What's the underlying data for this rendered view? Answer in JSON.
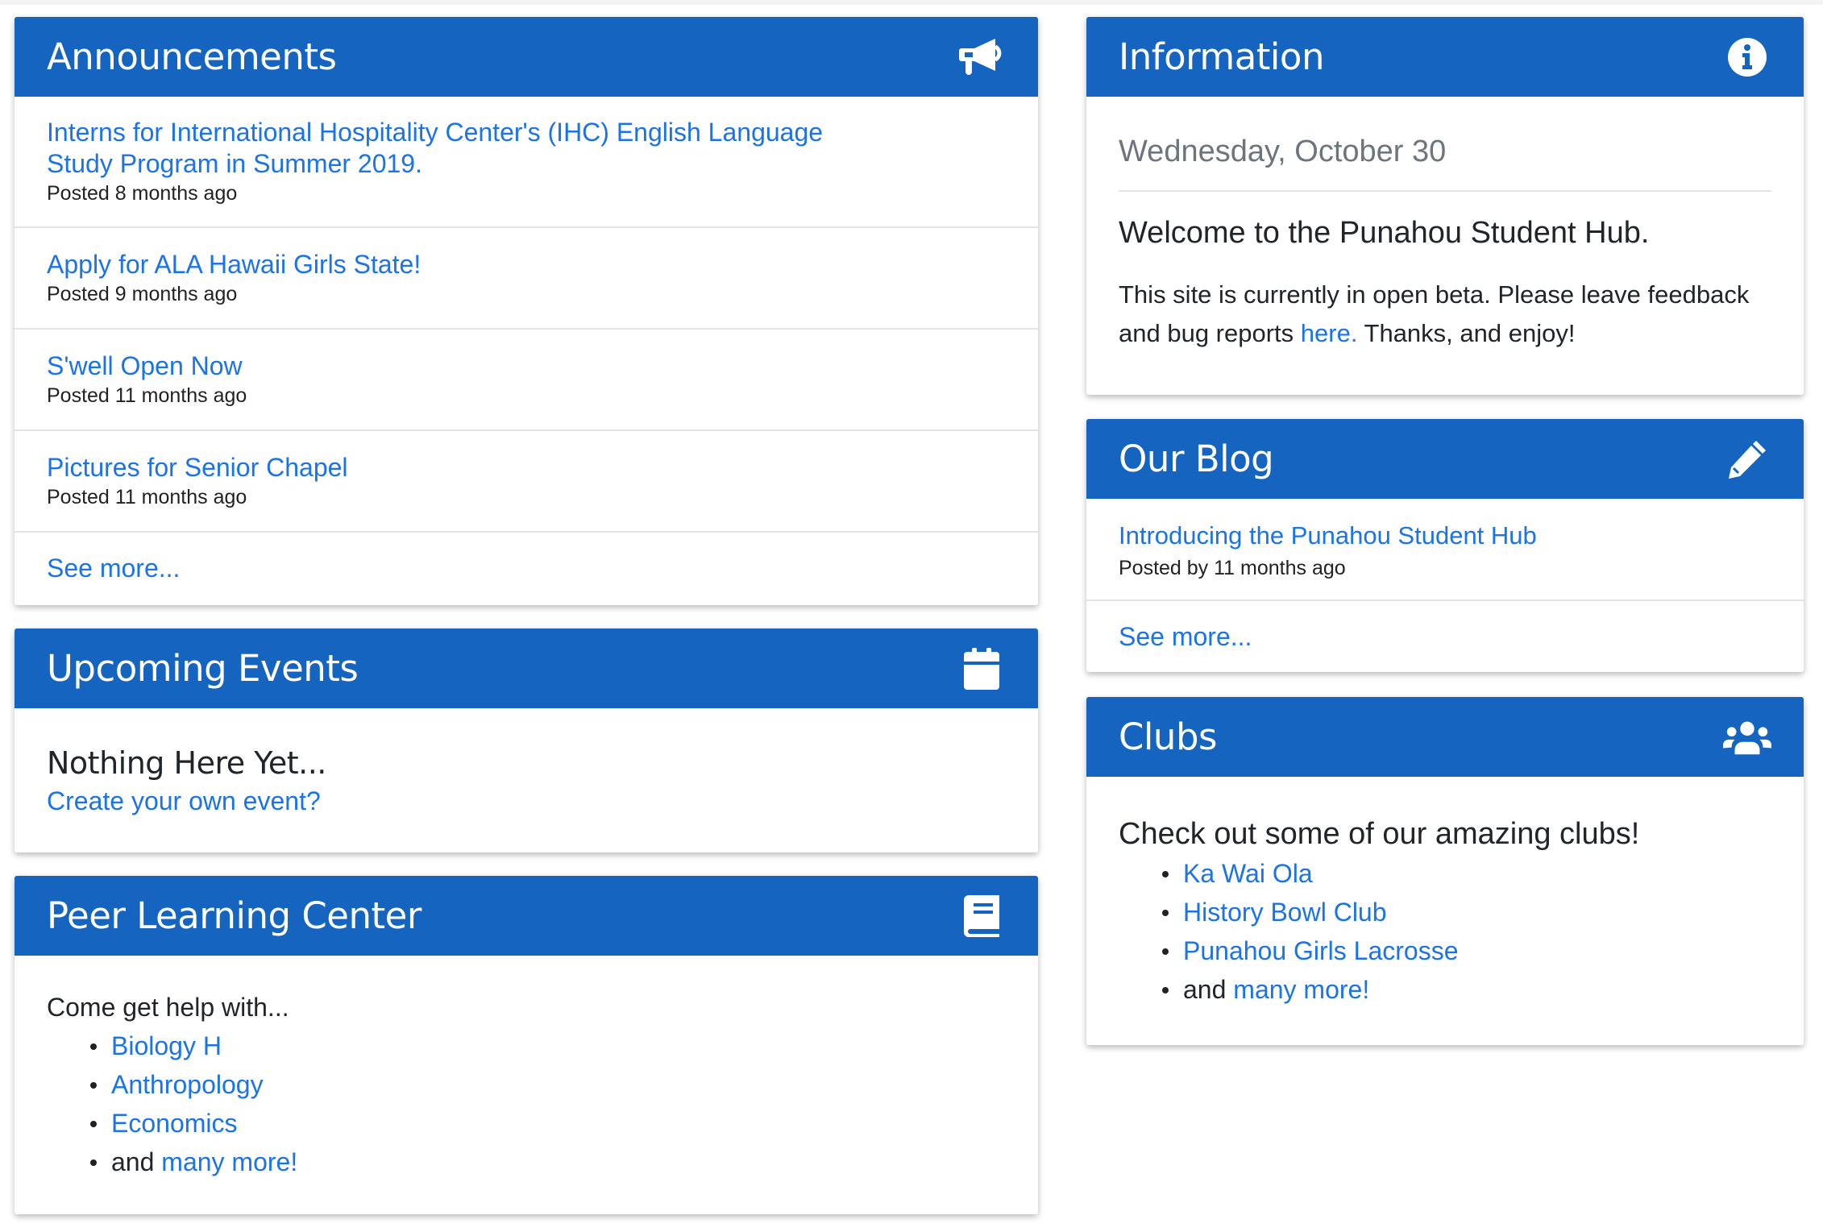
{
  "announcements": {
    "title": "Announcements",
    "icon": "megaphone-icon",
    "items": [
      {
        "title": "Interns for International Hospitality Center's (IHC) English Language Study Program in Summer 2019.",
        "meta": "Posted 8 months ago"
      },
      {
        "title": "Apply for ALA Hawaii Girls State!",
        "meta": "Posted 9 months ago"
      },
      {
        "title": "S'well Open Now",
        "meta": "Posted 11 months ago"
      },
      {
        "title": "Pictures for Senior Chapel",
        "meta": "Posted 11 months ago"
      }
    ],
    "see_more": "See more..."
  },
  "events": {
    "title": "Upcoming Events",
    "icon": "calendar-icon",
    "empty_text": "Nothing Here Yet...",
    "create_link": "Create your own event?"
  },
  "peer_learning": {
    "title": "Peer Learning Center",
    "icon": "book-icon",
    "intro": "Come get help with...",
    "subjects": [
      "Biology H",
      "Anthropology",
      "Economics"
    ],
    "and_text": "and",
    "more_link": "many more!"
  },
  "information": {
    "title": "Information",
    "icon": "info-circle-icon",
    "date": "Wednesday, October 30",
    "welcome": "Welcome to the Punahou Student Hub.",
    "body_before": "This site is currently in open beta. Please leave feedback and bug reports",
    "body_link": "here.",
    "body_after": "Thanks, and enjoy!"
  },
  "blog": {
    "title": "Our Blog",
    "icon": "pencil-icon",
    "post_title": "Introducing the Punahou Student Hub",
    "post_meta": "Posted by 11 months ago",
    "see_more": "See more..."
  },
  "clubs": {
    "title": "Clubs",
    "icon": "users-icon",
    "intro": "Check out some of our amazing clubs!",
    "items": [
      "Ka Wai Ola",
      "History Bowl Club",
      "Punahou Girls Lacrosse"
    ],
    "and_text": "and",
    "more_link": "many more!"
  },
  "colors": {
    "header_blue": "#1565c0",
    "link_blue": "#1a73e8"
  }
}
